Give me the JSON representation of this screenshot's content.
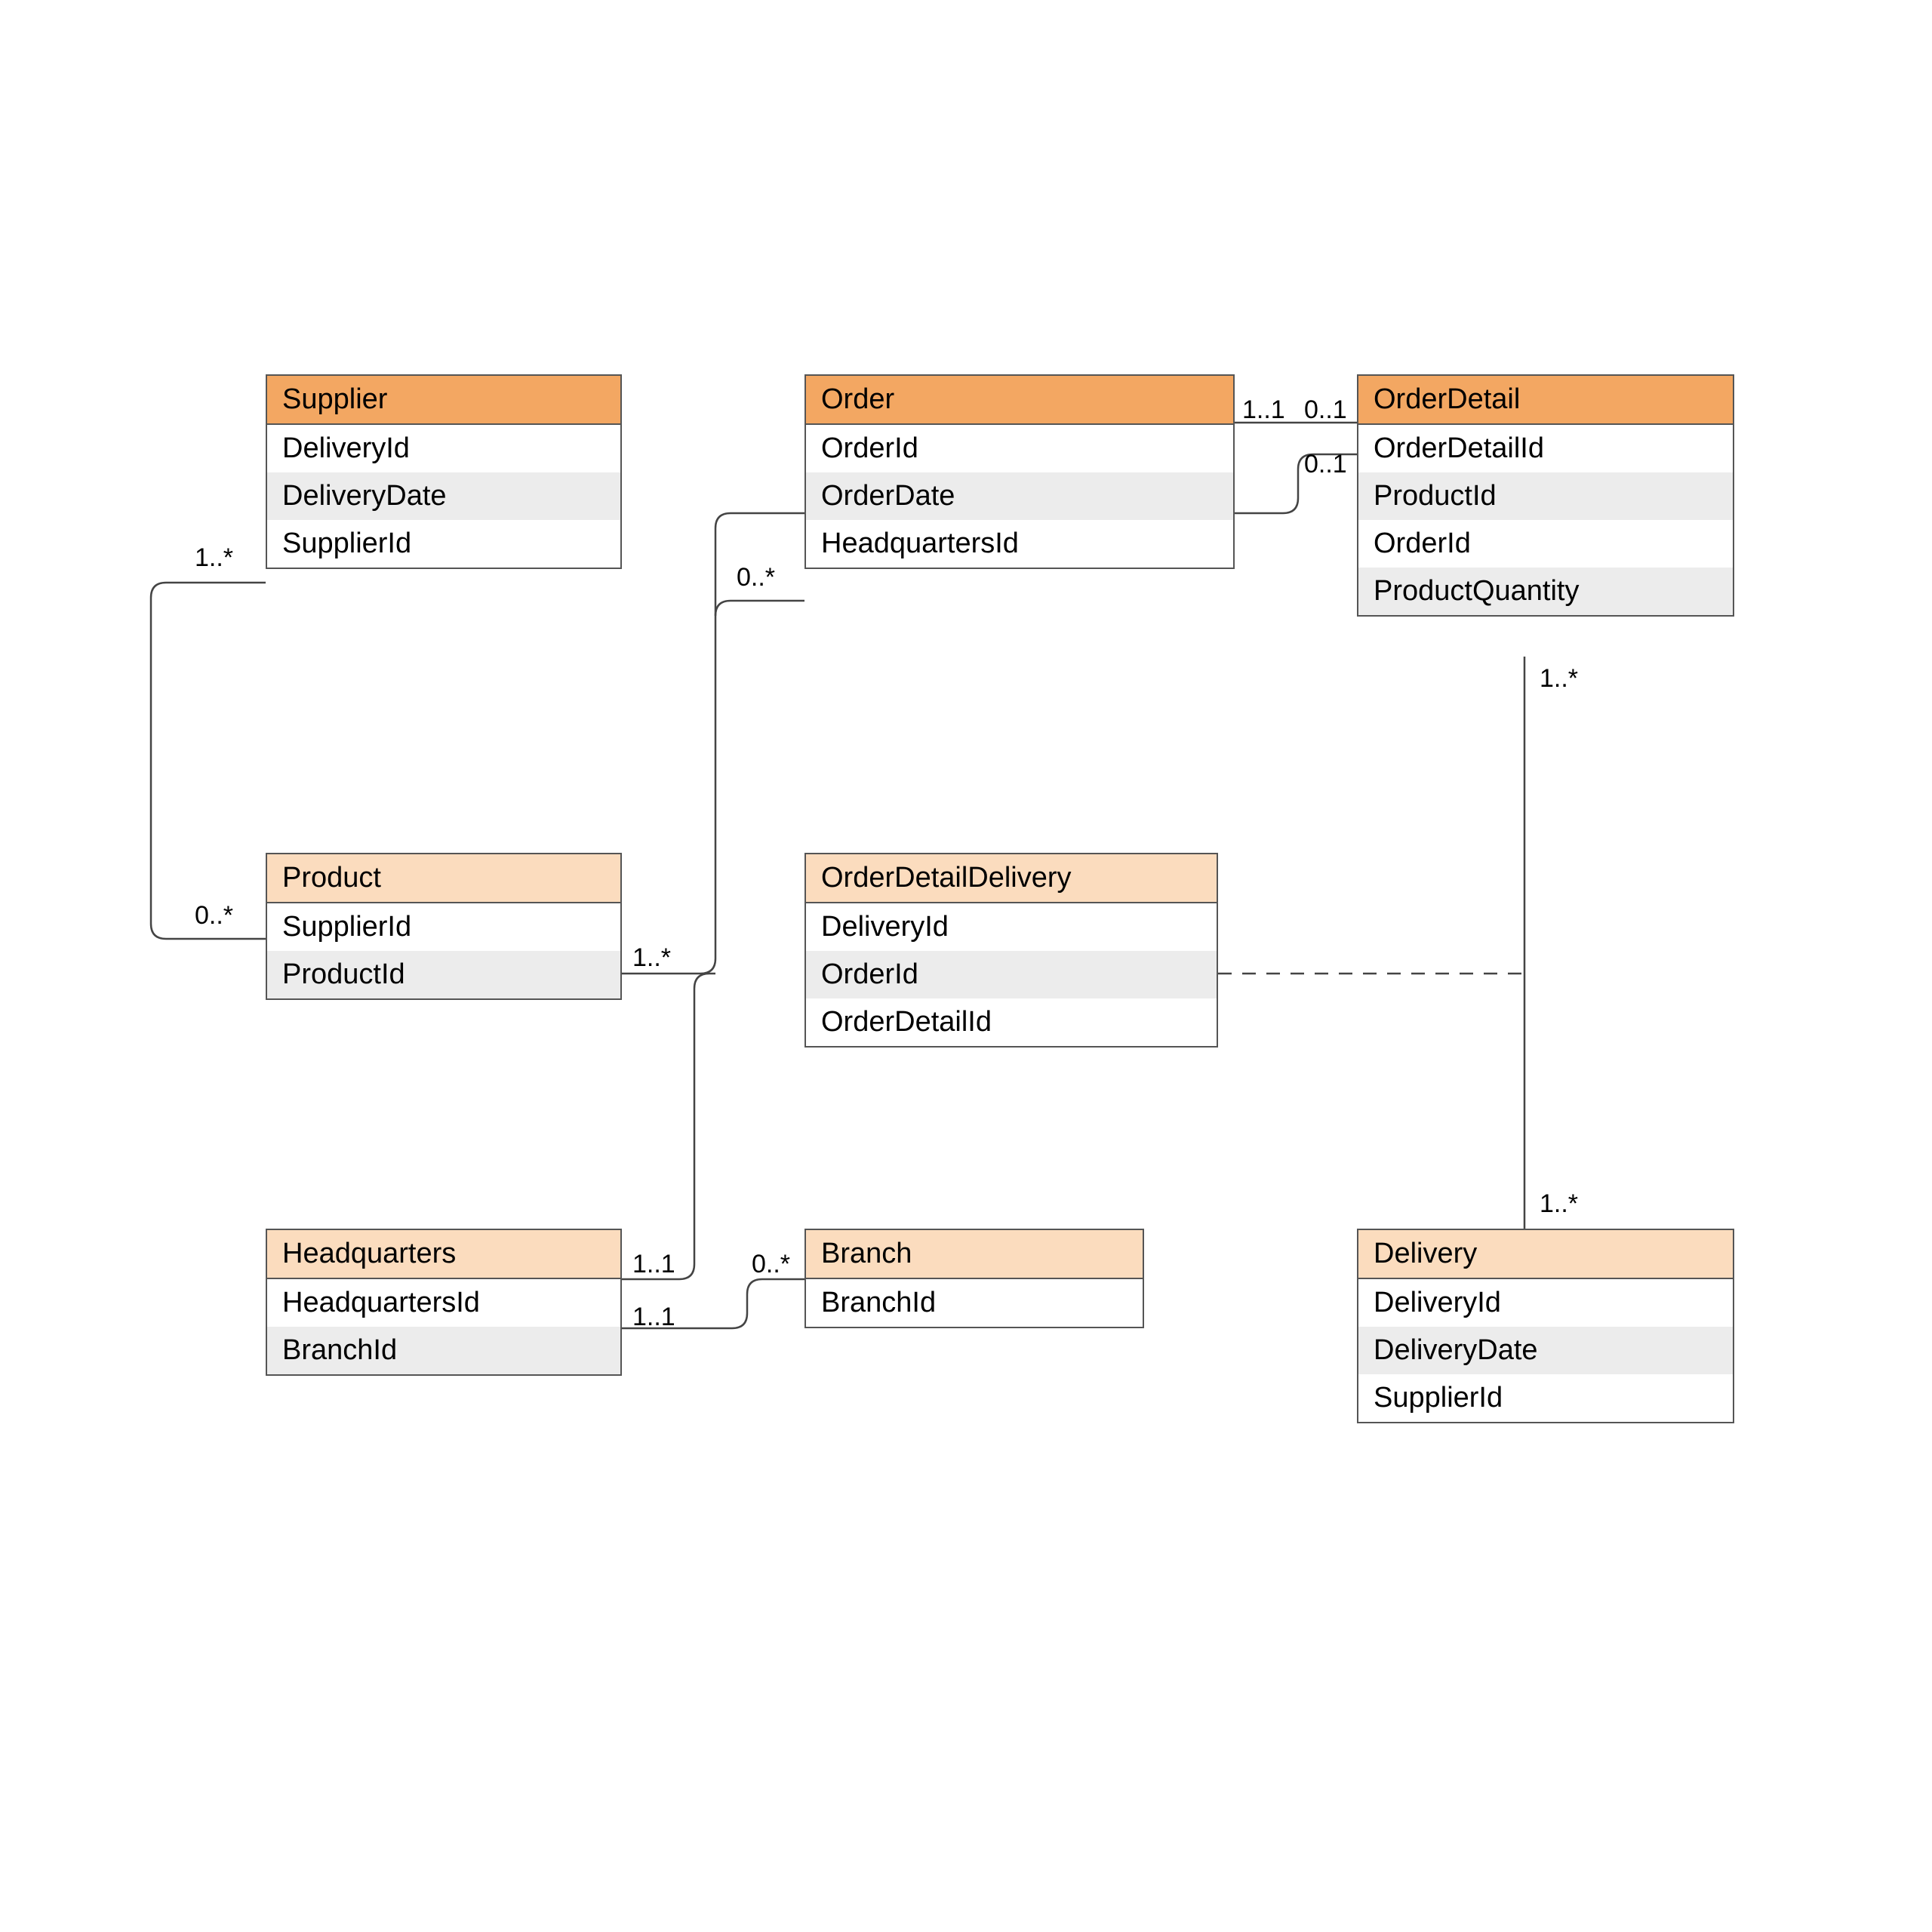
{
  "entities": {
    "supplier": {
      "title": "Supplier",
      "attrs": [
        "DeliveryId",
        "DeliveryDate",
        "SupplierId"
      ]
    },
    "order": {
      "title": "Order",
      "attrs": [
        "OrderId",
        "OrderDate",
        "HeadquartersId"
      ]
    },
    "orderDetail": {
      "title": "OrderDetail",
      "attrs": [
        "OrderDetailId",
        "ProductId",
        "OrderId",
        "ProductQuantity"
      ]
    },
    "product": {
      "title": "Product",
      "attrs": [
        "SupplierId",
        "ProductId"
      ]
    },
    "orderDetailDelivery": {
      "title": "OrderDetailDelivery",
      "attrs": [
        "DeliveryId",
        "OrderId",
        "OrderDetailId"
      ]
    },
    "headquarters": {
      "title": "Headquarters",
      "attrs": [
        "HeadquartersId",
        "BranchId"
      ]
    },
    "branch": {
      "title": "Branch",
      "attrs": [
        "BranchId"
      ]
    },
    "delivery": {
      "title": "Delivery",
      "attrs": [
        "DeliveryId",
        "DeliveryDate",
        "SupplierId"
      ]
    }
  },
  "multiplicities": {
    "supplier_product_top": "1..*",
    "supplier_product_bottom": "0..*",
    "order_left": "0..*",
    "order_right": "1..1",
    "orderDetail_topLeft": "0..1",
    "orderDetail_left2": "0..1",
    "orderDetail_bottom": "1..*",
    "product_right": "1..*",
    "headquarters_order": "1..1",
    "headquarters_branch": "1..1",
    "branch_left": "0..*",
    "delivery_top": "1..*"
  }
}
